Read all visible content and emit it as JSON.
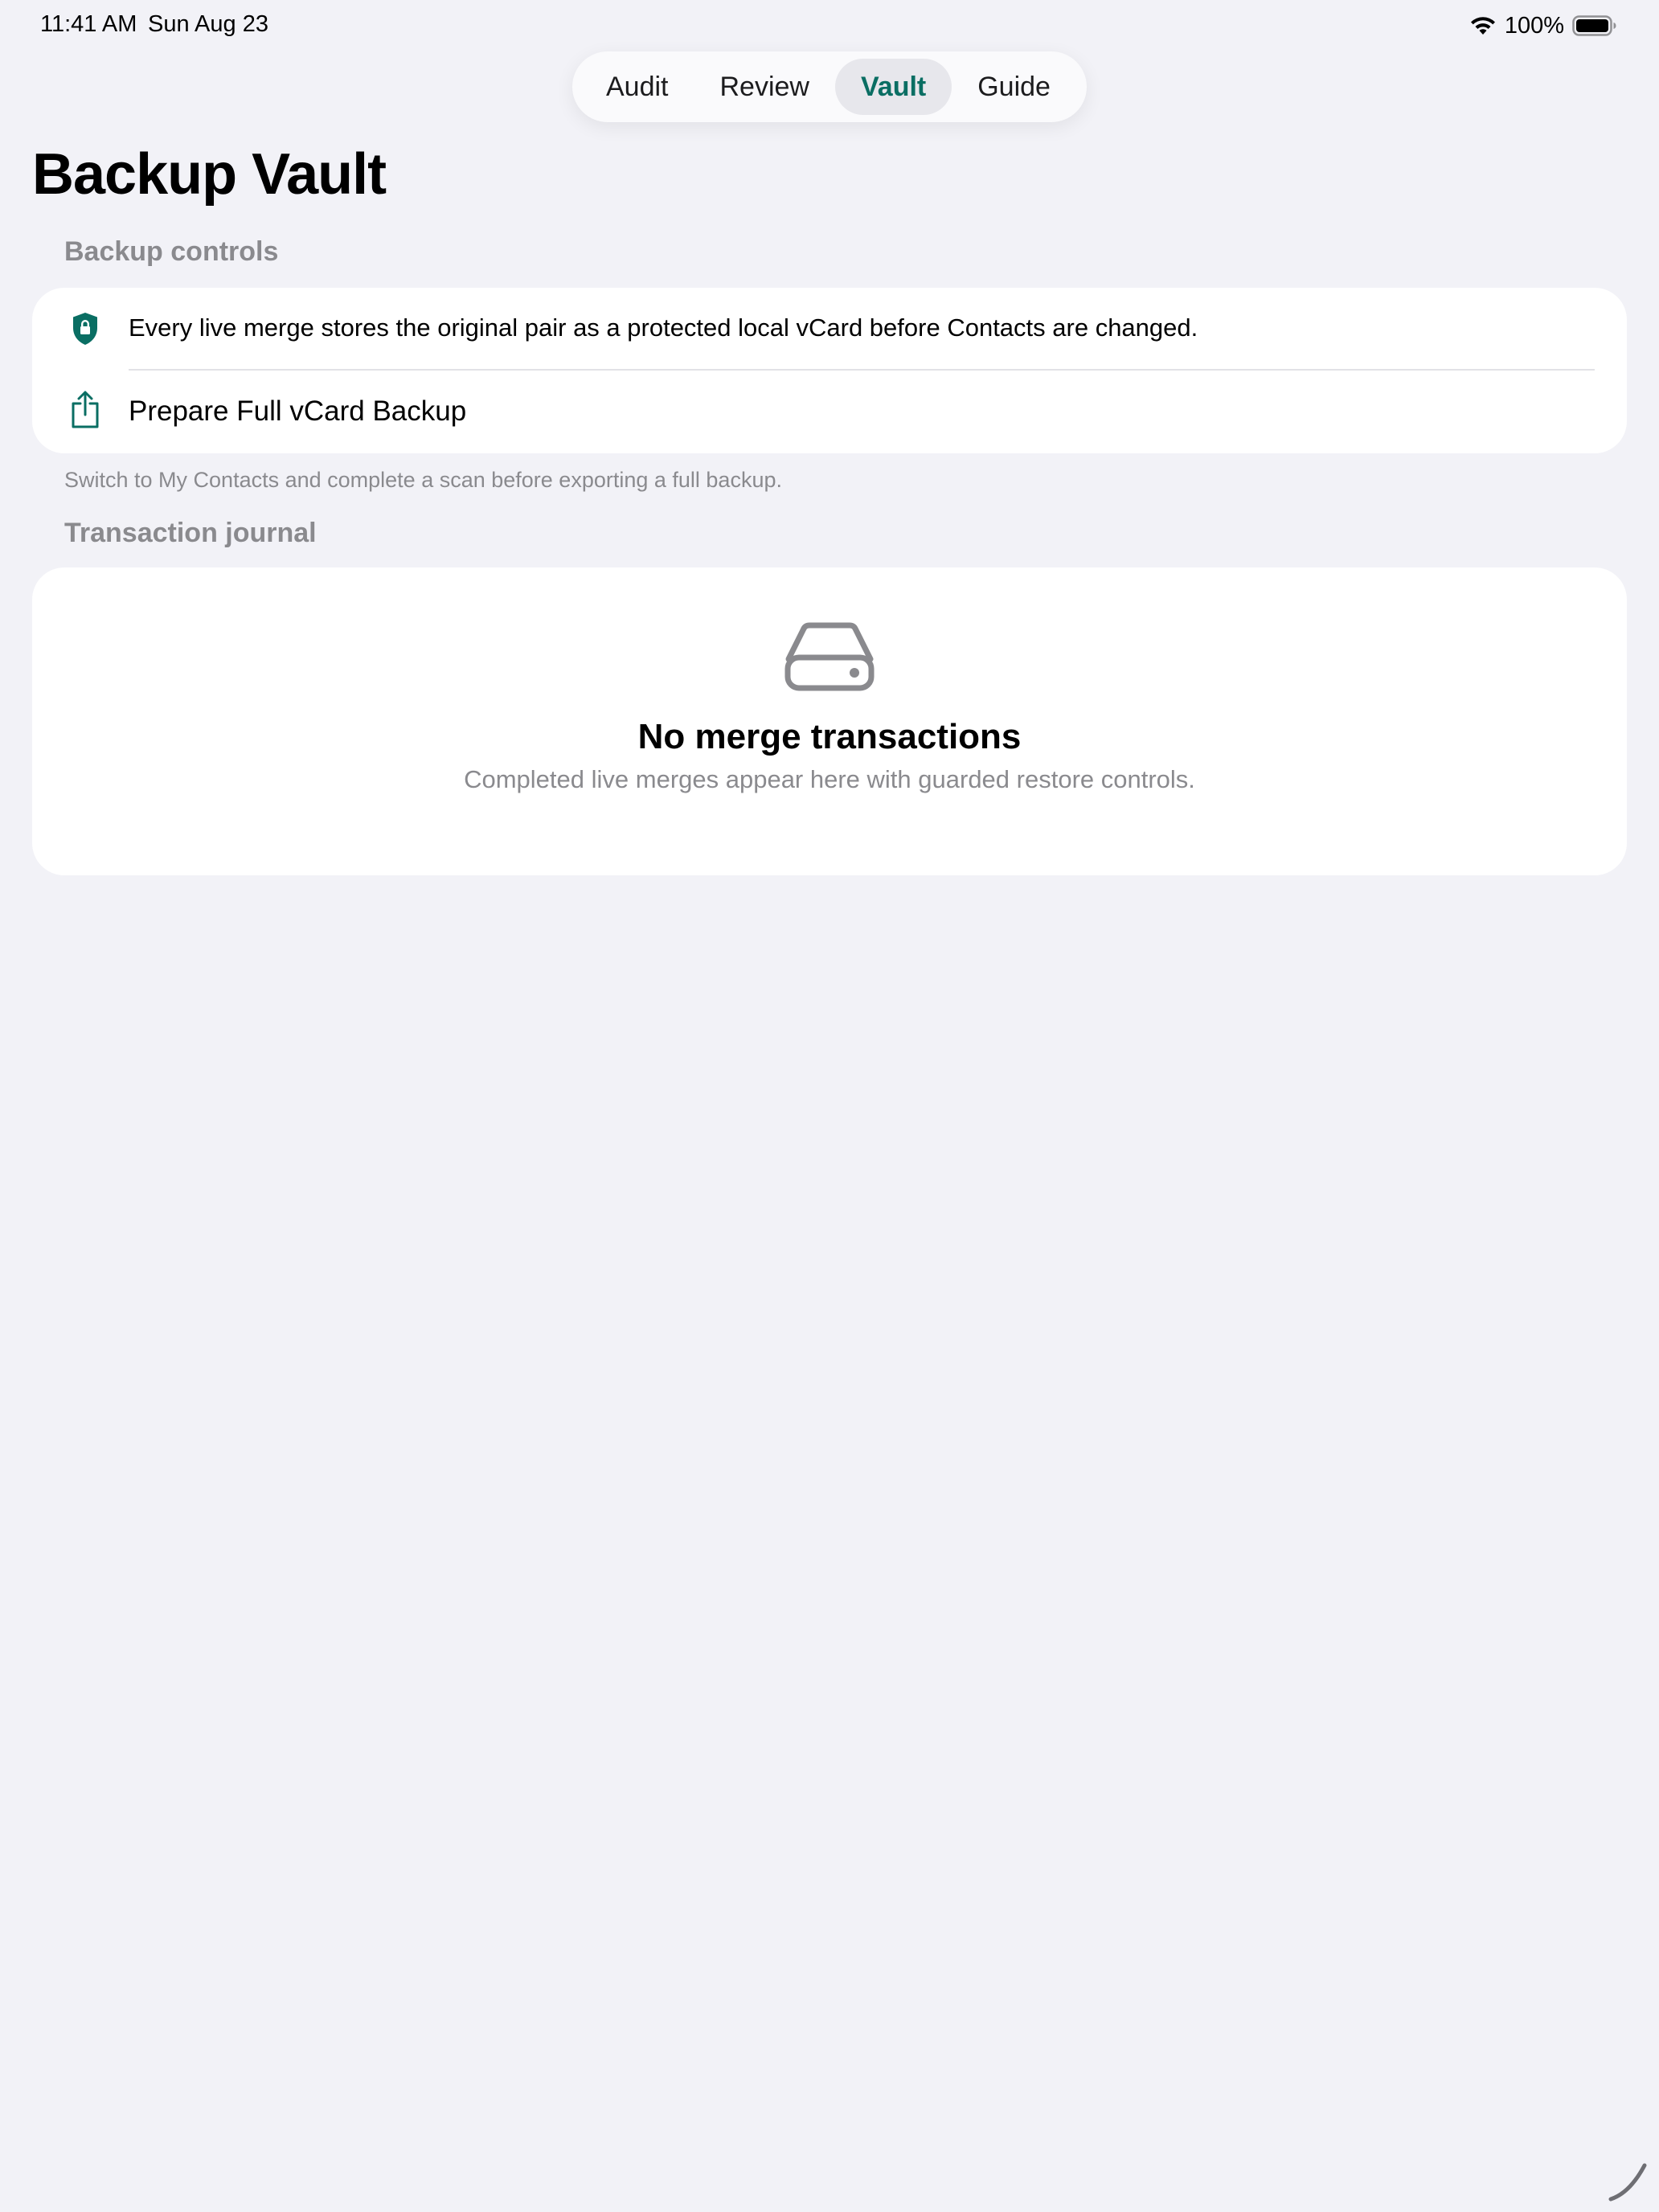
{
  "status_bar": {
    "time": "11:41 AM",
    "date": "Sun Aug 23",
    "battery": "100%",
    "icons": [
      "wifi-icon",
      "battery-icon"
    ]
  },
  "tabs": [
    {
      "label": "Audit",
      "active": false
    },
    {
      "label": "Review",
      "active": false
    },
    {
      "label": "Vault",
      "active": true
    },
    {
      "label": "Guide",
      "active": false
    }
  ],
  "page": {
    "title": "Backup Vault"
  },
  "backup_controls": {
    "header": "Backup controls",
    "info_row": {
      "icon": "lock-shield-icon",
      "text": "Every live merge stores the original pair as a protected local vCard before Contacts are changed."
    },
    "action_row": {
      "icon": "share-icon",
      "label": "Prepare Full vCard Backup"
    },
    "footnote": "Switch to My Contacts and complete a scan before exporting a full backup."
  },
  "transaction_journal": {
    "header": "Transaction journal",
    "empty_state": {
      "icon": "drive-icon",
      "title": "No merge transactions",
      "subtitle": "Completed live merges appear here with guarded restore controls."
    }
  },
  "colors": {
    "accent": "#0a6e63",
    "background": "#f2f2f7",
    "secondary_text": "#8a8a8e"
  }
}
